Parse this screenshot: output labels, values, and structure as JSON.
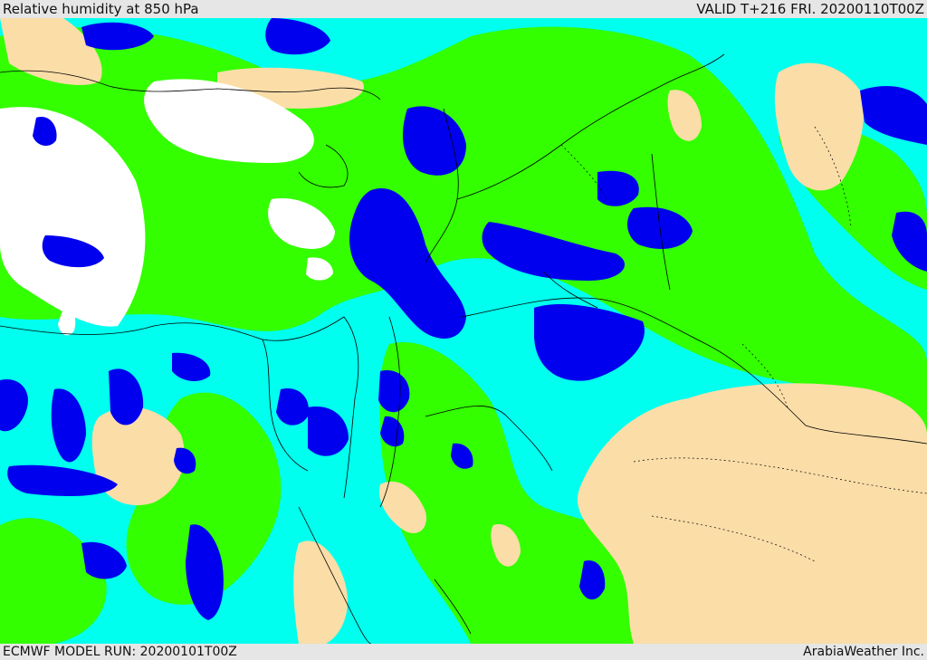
{
  "header": {
    "title": "Relative humidity at 850 hPa",
    "valid": "VALID T+216 FRI. 20200110T00Z"
  },
  "footer": {
    "model_run": "ECMWF MODEL RUN: 20200101T00Z",
    "credit": "ArabiaWeather Inc."
  },
  "map": {
    "colors": {
      "very_humid": "#0000ee",
      "humid": "#00ffee",
      "moderate": "#33ff00",
      "dry": "#fbdda8",
      "no_data": "#ffffff",
      "borders": "#000000"
    }
  }
}
